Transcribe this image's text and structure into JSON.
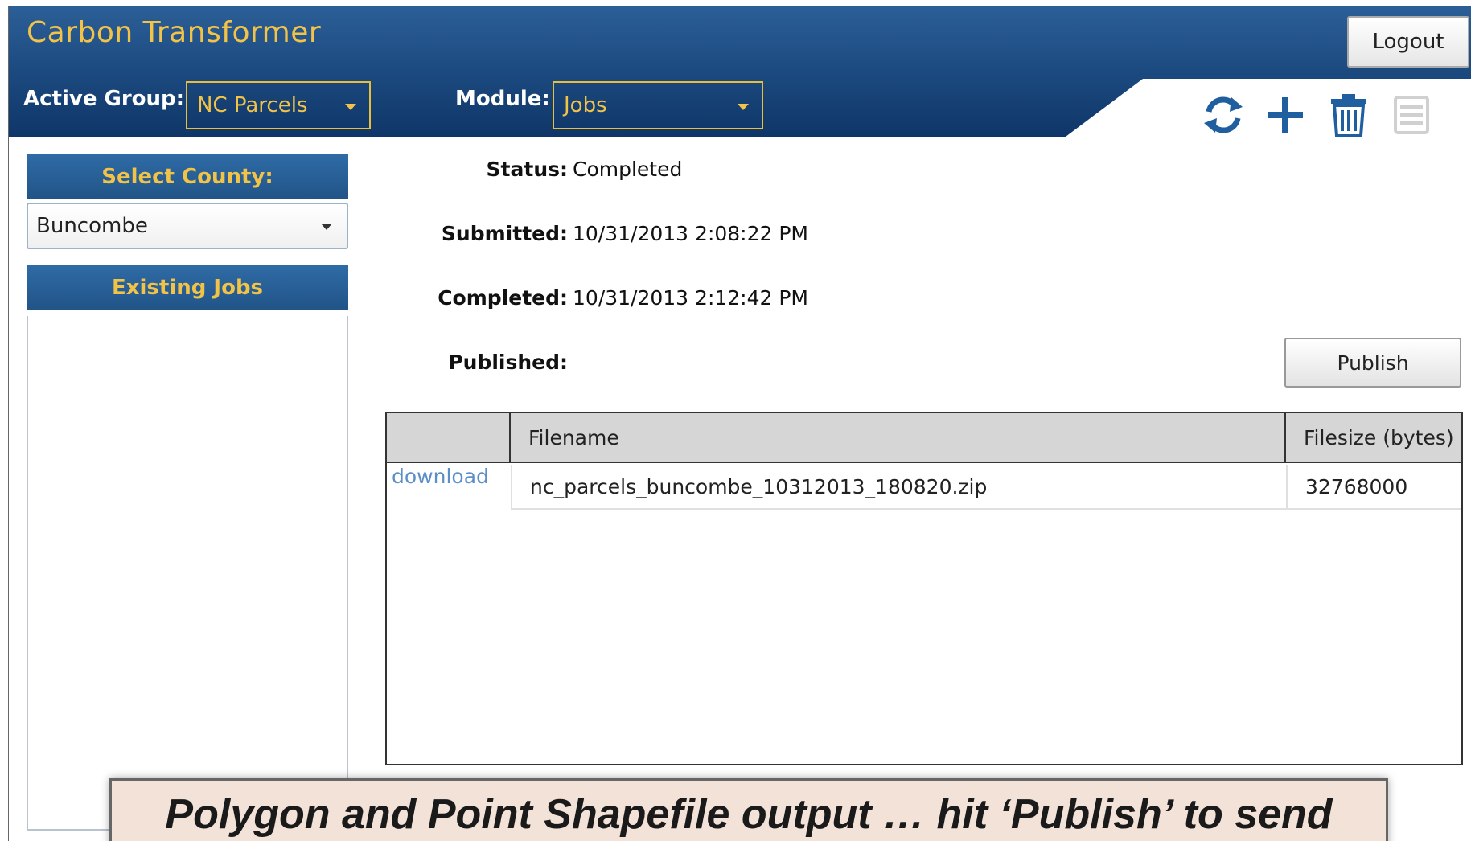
{
  "app": {
    "title": "Carbon Transformer",
    "logout_label": "Logout"
  },
  "header": {
    "active_group_label": "Active Group:",
    "active_group_value": "NC Parcels",
    "module_label": "Module:",
    "module_value": "Jobs"
  },
  "toolbar": {
    "icons": [
      "refresh-icon",
      "add-icon",
      "trash-icon",
      "list-icon"
    ]
  },
  "sidebar": {
    "select_county_title": "Select County:",
    "county_value": "Buncombe",
    "existing_jobs_title": "Existing Jobs"
  },
  "job": {
    "status_label": "Status:",
    "status_value": "Completed",
    "submitted_label": "Submitted:",
    "submitted_value": "10/31/2013 2:08:22 PM",
    "completed_label": "Completed:",
    "completed_value": "10/31/2013 2:12:42 PM",
    "published_label": "Published:",
    "published_value": "",
    "publish_button": "Publish"
  },
  "files": {
    "columns": [
      "",
      "Filename",
      "Filesize (bytes)"
    ],
    "rows": [
      {
        "link": "download",
        "filename": "nc_parcels_buncombe_10312013_180820.zip",
        "filesize": "32768000"
      }
    ]
  },
  "caption": "Polygon and Point Shapefile output … hit ‘Publish’ to send",
  "colors": {
    "header": "#1d4c82",
    "accent": "#f2c347",
    "link": "#5b8fc8",
    "caption_bg": "#f3e2d8"
  }
}
